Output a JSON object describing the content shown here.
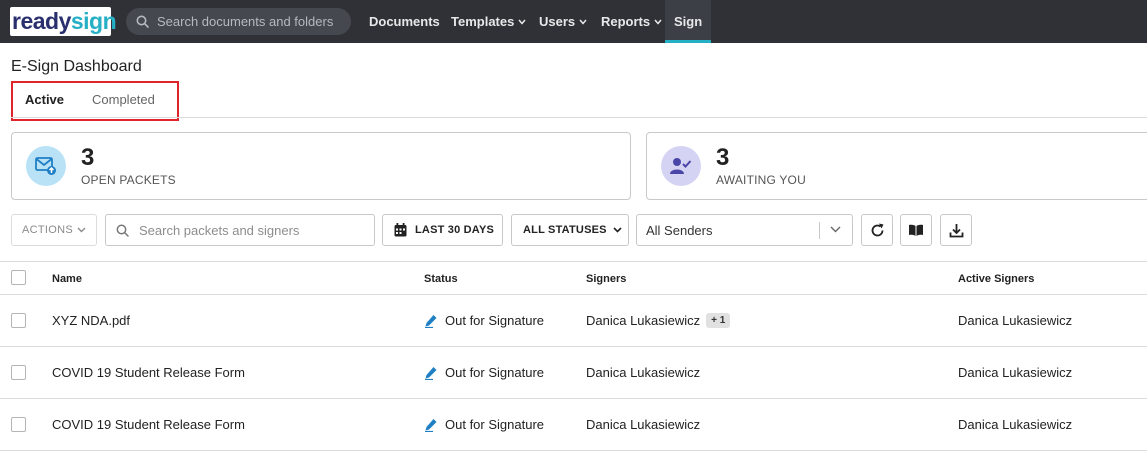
{
  "navbar": {
    "logo_part1": "ready",
    "logo_part2": "sign",
    "search_placeholder": "Search documents and folders",
    "items": [
      {
        "label": "Documents"
      },
      {
        "label": "Templates"
      },
      {
        "label": "Users"
      },
      {
        "label": "Reports"
      },
      {
        "label": "Sign"
      }
    ],
    "active_item": "Sign",
    "accent_color": "#25b0c6"
  },
  "page": {
    "title": "E-Sign Dashboard",
    "tabs": [
      {
        "label": "Active"
      },
      {
        "label": "Completed"
      }
    ],
    "selected_tab": "Active",
    "highlight_color": "#e0242c"
  },
  "stats": [
    {
      "value": "3",
      "label": "OPEN PACKETS",
      "icon": "envelope-upload-icon"
    },
    {
      "value": "3",
      "label": "AWAITING YOU",
      "icon": "user-check-icon"
    }
  ],
  "toolbar": {
    "actions_label": "ACTIONS",
    "search_placeholder": "Search packets and signers",
    "date_range_label": "LAST 30 DAYS",
    "status_filter_label": "ALL STATUSES",
    "sender_filter_value": "All Senders"
  },
  "table": {
    "columns": [
      "Name",
      "Status",
      "Signers",
      "Active Signers"
    ],
    "rows": [
      {
        "name": "XYZ NDA.pdf",
        "status": "Out for Signature",
        "signers": "Danica Lukasiewicz",
        "extra_signers": "+ 1",
        "active_signers": "Danica Lukasiewicz"
      },
      {
        "name": "COVID 19 Student Release Form",
        "status": "Out for Signature",
        "signers": "Danica Lukasiewicz",
        "active_signers": "Danica Lukasiewicz"
      },
      {
        "name": "COVID 19 Student Release Form",
        "status": "Out for Signature",
        "signers": "Danica Lukasiewicz",
        "active_signers": "Danica Lukasiewicz"
      }
    ]
  }
}
